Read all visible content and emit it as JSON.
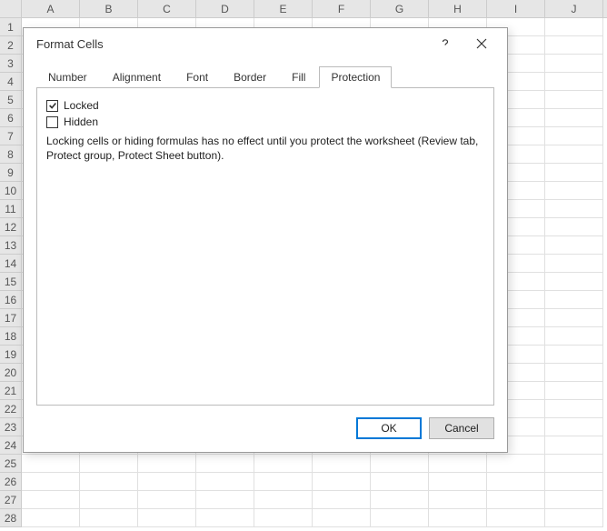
{
  "sheet": {
    "columns": [
      "A",
      "B",
      "C",
      "D",
      "E",
      "F",
      "G",
      "H",
      "I",
      "J"
    ],
    "rowCount": 28
  },
  "dialog": {
    "title": "Format Cells",
    "tabs": [
      {
        "label": "Number"
      },
      {
        "label": "Alignment"
      },
      {
        "label": "Font"
      },
      {
        "label": "Border"
      },
      {
        "label": "Fill"
      },
      {
        "label": "Protection"
      }
    ],
    "activeTabIndex": 5,
    "protection": {
      "lockedLabel": "Locked",
      "lockedChecked": true,
      "hiddenLabel": "Hidden",
      "hiddenChecked": false,
      "info": "Locking cells or hiding formulas has no effect until you protect the worksheet (Review tab, Protect group, Protect Sheet button)."
    },
    "buttons": {
      "ok": "OK",
      "cancel": "Cancel"
    }
  }
}
